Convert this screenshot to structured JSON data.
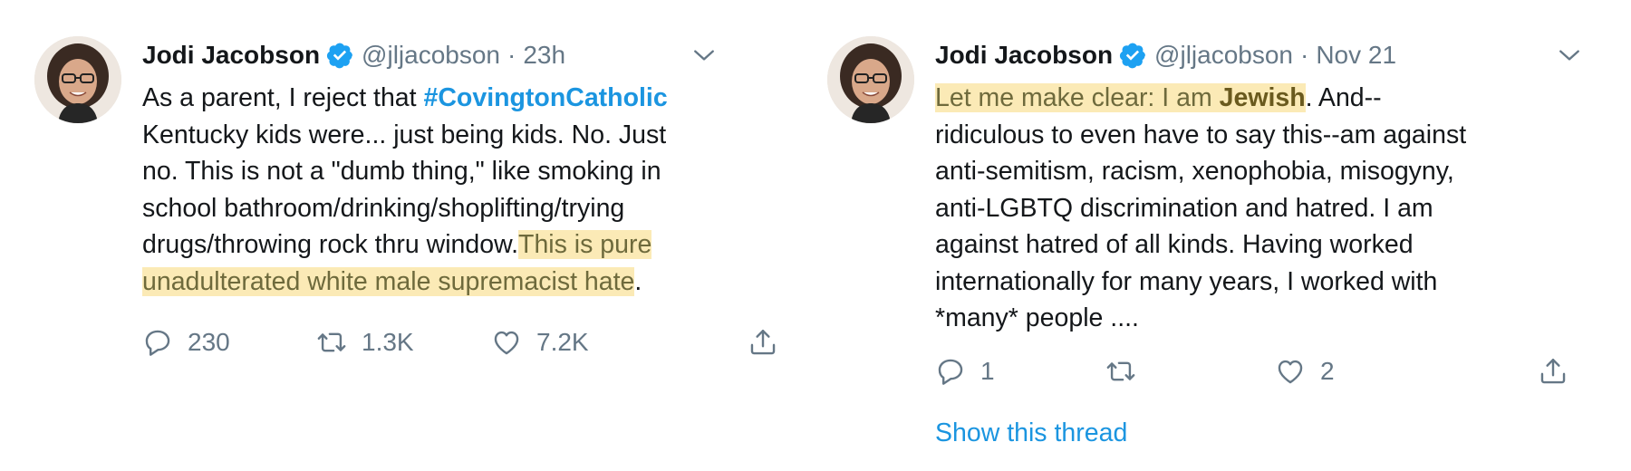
{
  "tweets": [
    {
      "author_name": "Jodi Jacobson",
      "handle": "@jljacobson",
      "separator": "·",
      "time": "23h",
      "text": {
        "l1_pre": "As a parent, I reject that ",
        "l1_hashtag": "#CovingtonCatholic",
        "l2": "Kentucky kids were... just being kids. No. Just",
        "l3": "no. This is not a \"dumb thing,\" like smoking in",
        "l4": "school bathroom/drinking/shoplifting/trying",
        "l5_pre": "drugs/throwing rock thru window.",
        "l5_hl": "This is pure",
        "l6_hl": "unadulterated white male supremacist hate",
        "l6_post": "."
      },
      "reply_count": "230",
      "retweet_count": "1.3K",
      "like_count": "7.2K"
    },
    {
      "author_name": "Jodi Jacobson",
      "handle": "@jljacobson",
      "separator": "·",
      "time": "Nov 21",
      "text": {
        "l1_hl": "Let me make clear: I am ",
        "l1_hl_bold": "Jewish",
        "l1_post": ". And--",
        "l2": "ridiculous to even have to say this--am against",
        "l3": "anti-semitism, racism, xenophobia, misogyny,",
        "l4": "anti-LGBTQ discrimination and hatred. I am",
        "l5": "against hatred of all kinds. Having worked",
        "l6": "internationally for many years, I worked with",
        "l7": "*many* people ...."
      },
      "reply_count": "1",
      "retweet_count": "",
      "like_count": "2",
      "show_thread": "Show this thread"
    }
  ],
  "colors": {
    "link_blue": "#1b95e0",
    "verified_blue": "#1da1f2",
    "muted_gray": "#657786",
    "highlight_yellow": "#fbeab6"
  },
  "icons": [
    "avatar",
    "verified-badge-icon",
    "chevron-down-icon",
    "reply-icon",
    "retweet-icon",
    "like-icon",
    "share-icon"
  ]
}
